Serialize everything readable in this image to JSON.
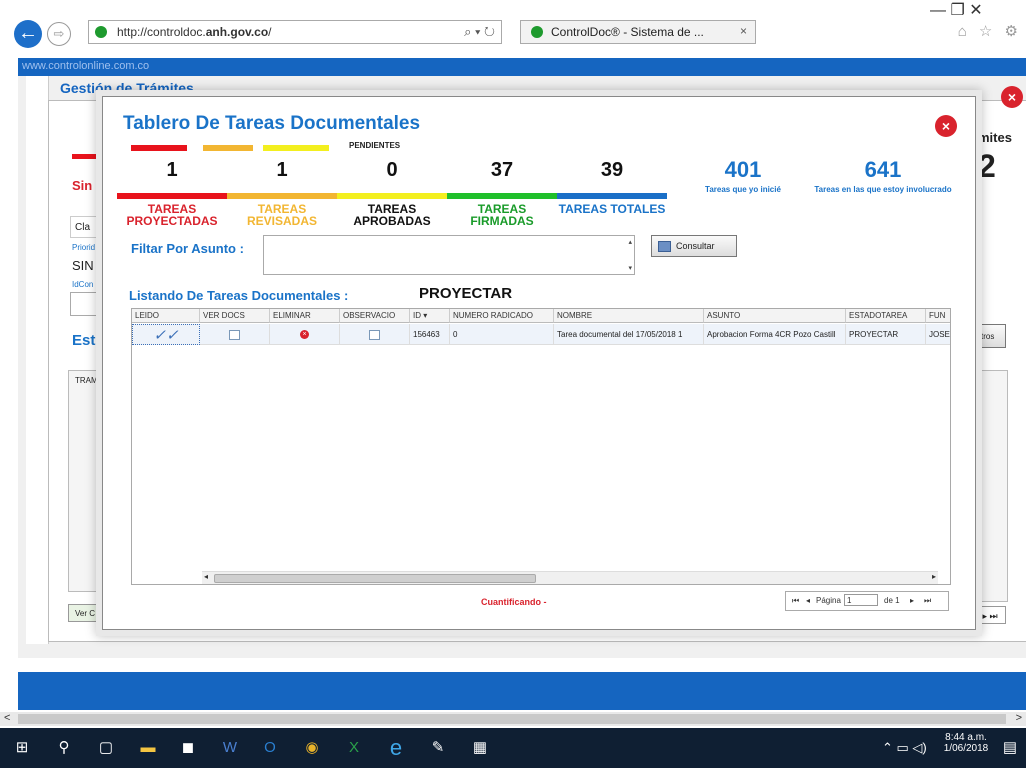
{
  "browser": {
    "url_prefix": "http://controldoc.",
    "url_domain": "anh.gov.co",
    "url_suffix": "/",
    "tab_title": "ControlDoc® - Sistema de ...",
    "search_refresh": "⌕ ▾ ↻",
    "tab_close": "×",
    "window_controls": "—   ❐   ✕",
    "toolbar_icons": "⌂ ☆ ⚙"
  },
  "background_page": {
    "site_link": "www.controlonline.com.co",
    "title": "Gestión de Trámites",
    "right_label": "mites",
    "right_number": "2",
    "left_texts": [
      "Sin i",
      "Cla",
      "Priorid",
      "SIN",
      "IdCon",
      "Est",
      "TRAM",
      "Ver C"
    ],
    "right_button": "tros"
  },
  "modal": {
    "title": "Tablero De Tareas Documentales",
    "pendientes": "PENDIENTES",
    "counters": [
      {
        "count": "1",
        "label": "TAREAS PROYECTADAS",
        "color": "#e8131c"
      },
      {
        "count": "1",
        "label": "TAREAS REVISADAS",
        "color": "#f2b632"
      },
      {
        "count": "0",
        "label": "TAREAS APROBADAS",
        "color": "#f3ef1f"
      },
      {
        "count": "37",
        "label": "TAREAS FIRMADAS",
        "color": "#1fbf2a"
      },
      {
        "count": "39",
        "label": "TAREAS TOTALES",
        "color": "#1a6fc7"
      }
    ],
    "extra": [
      {
        "count": "401",
        "label": "Tareas que yo inicié"
      },
      {
        "count": "641",
        "label": "Tareas en las que estoy involucrado"
      }
    ],
    "filter_label": "Filtar Por Asunto :",
    "consultar": "Consultar",
    "listing_label": "Listando De Tareas Documentales :",
    "listing_state": "PROYECTAR",
    "columns": [
      "LEIDO",
      "VER DOCS",
      "ELIMINAR",
      "OBSERVACIO",
      "ID ▾",
      "NUMERO RADICADO",
      "NOMBRE",
      "ASUNTO",
      "ESTADOTAREA",
      "FUN"
    ],
    "row": {
      "leido": "✓✓",
      "id": "156463",
      "numero_radicado": "0",
      "nombre": "Tarea documental del 17/05/2018 1",
      "asunto": "Aprobacion Forma 4CR Pozo Castill",
      "estado": "PROYECTAR",
      "fun": "JOSE"
    },
    "status": "Cuantificando -",
    "pager": {
      "first": "⏮",
      "prev": "◂",
      "page_label": "Página",
      "page_value": "1",
      "of_label": "de 1",
      "next": "▸",
      "last": "⏭"
    }
  },
  "taskbar": {
    "time": "8:44 a.m.",
    "date": "1/06/2018",
    "tray": "⌃ ▭ ◁)"
  }
}
